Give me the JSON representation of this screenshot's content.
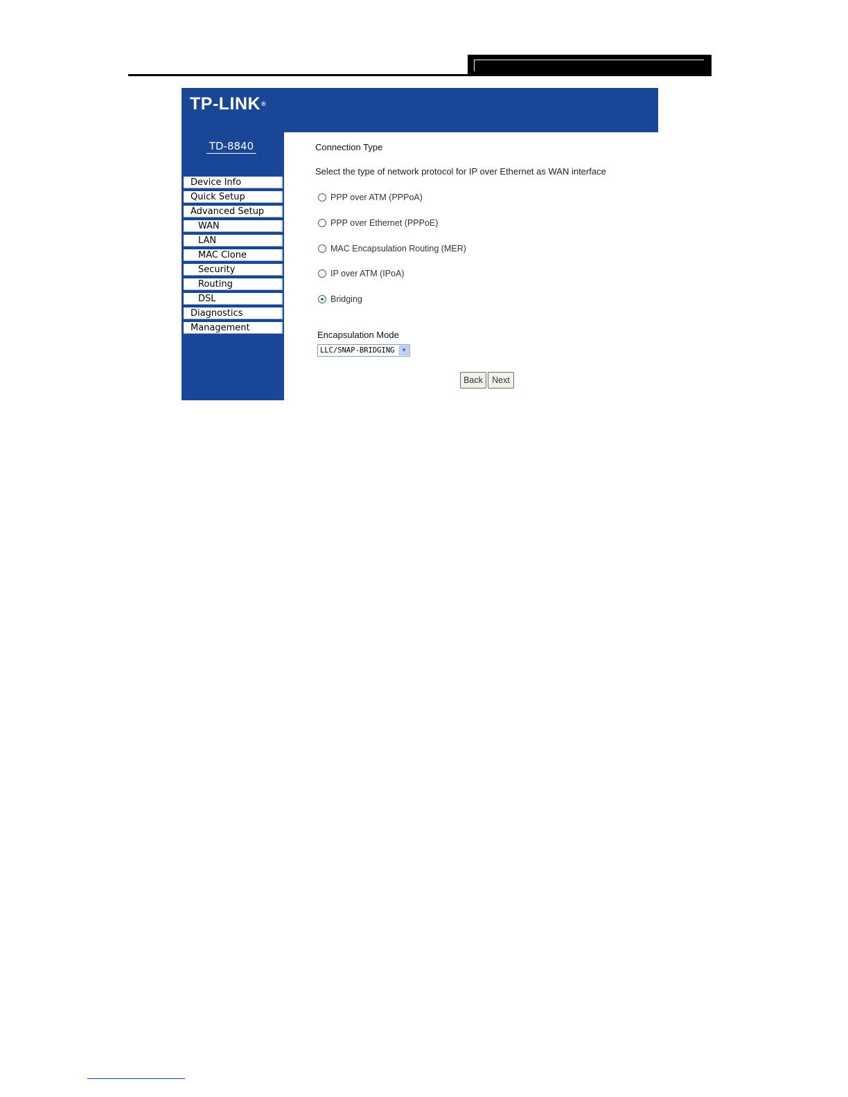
{
  "brand": {
    "logo_text": "TP-LINK",
    "logo_mark": "®",
    "model": "TD-8840"
  },
  "sidebar": {
    "items": [
      {
        "label": "Device Info"
      },
      {
        "label": "Quick Setup"
      },
      {
        "label": "Advanced Setup"
      },
      {
        "label": "WAN"
      },
      {
        "label": "LAN"
      },
      {
        "label": "MAC Clone"
      },
      {
        "label": "Security"
      },
      {
        "label": "Routing"
      },
      {
        "label": "DSL"
      },
      {
        "label": "Diagnostics"
      },
      {
        "label": "Management"
      }
    ]
  },
  "main": {
    "title": "Connection Type",
    "description": "Select the type of network protocol for IP over Ethernet as WAN interface",
    "options": [
      {
        "label": "PPP over ATM (PPPoA)",
        "checked": false
      },
      {
        "label": "PPP over Ethernet (PPPoE)",
        "checked": false
      },
      {
        "label": "MAC Encapsulation Routing (MER)",
        "checked": false
      },
      {
        "label": "IP over ATM (IPoA)",
        "checked": false
      },
      {
        "label": "Bridging",
        "checked": true
      }
    ],
    "encapsulation_label": "Encapsulation Mode",
    "encapsulation_value": "LLC/SNAP-BRIDGING",
    "back_label": "Back",
    "next_label": "Next"
  },
  "colors": {
    "brand_blue": "#1a4698",
    "selected_radio": "#2a8a3a"
  }
}
